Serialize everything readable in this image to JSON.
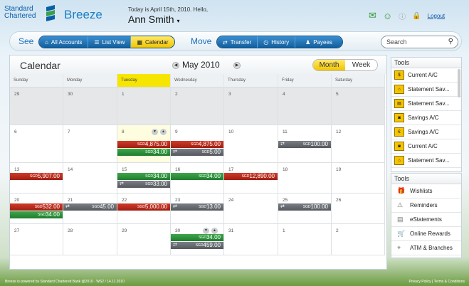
{
  "header": {
    "logo_line1": "Standard",
    "logo_line2": "Chartered",
    "brand": "Breeze",
    "greeting": "Today is April 15th, 2010. Hello,",
    "user": "Ann Smith",
    "logout": "Logout"
  },
  "nav": {
    "see": "See",
    "move": "Move",
    "see_buttons": [
      {
        "label": "All Accounts"
      },
      {
        "label": "List View"
      },
      {
        "label": "Calendar"
      }
    ],
    "move_buttons": [
      {
        "label": "Transfer"
      },
      {
        "label": "History"
      },
      {
        "label": "Payees"
      }
    ],
    "search_placeholder": "Search"
  },
  "calendar": {
    "title": "Calendar",
    "month": "May 2010",
    "view_month": "Month",
    "view_week": "Week",
    "days": [
      "Sunday",
      "Monday",
      "Tuesday",
      "Wednesday",
      "Thursday",
      "Friday",
      "Saturday"
    ],
    "weeks": [
      [
        {
          "d": "29"
        },
        {
          "d": "30"
        },
        {
          "d": "1"
        },
        {
          "d": "2"
        },
        {
          "d": "3"
        },
        {
          "d": "4"
        },
        {
          "d": "5"
        }
      ],
      [
        {
          "d": "6"
        },
        {
          "d": "7"
        },
        {
          "d": "8",
          "ev": [
            {
              "c": "red",
              "t": "4,875.00"
            },
            {
              "c": "green",
              "t": "34.00"
            }
          ]
        },
        {
          "d": "9",
          "ev": [
            {
              "c": "red",
              "t": "4,875.00"
            },
            {
              "c": "grey",
              "t": "5.00",
              "ar": true
            }
          ]
        },
        {
          "d": "10"
        },
        {
          "d": "11",
          "ev": [
            {
              "c": "grey",
              "t": "100.00",
              "ar": true
            }
          ]
        },
        {
          "d": "12"
        }
      ],
      [
        {
          "d": "13",
          "ev": [
            {
              "c": "red",
              "t": "5,907.00"
            }
          ]
        },
        {
          "d": "14"
        },
        {
          "d": "15",
          "ev": [
            {
              "c": "green",
              "t": "34.00"
            },
            {
              "c": "grey",
              "t": "33.00",
              "ar": true
            }
          ]
        },
        {
          "d": "16",
          "ev": [
            {
              "c": "green",
              "t": "34.00"
            }
          ]
        },
        {
          "d": "17",
          "ev": [
            {
              "c": "red",
              "t": "12,890.00"
            }
          ]
        },
        {
          "d": "18"
        },
        {
          "d": "19"
        }
      ],
      [
        {
          "d": "20",
          "ev": [
            {
              "c": "red",
              "t": "532.00"
            },
            {
              "c": "green",
              "t": "34.00"
            }
          ]
        },
        {
          "d": "21",
          "ev": [
            {
              "c": "grey",
              "t": "45.00",
              "ar": true
            }
          ]
        },
        {
          "d": "22",
          "ev": [
            {
              "c": "red",
              "t": "5,000.00"
            }
          ]
        },
        {
          "d": "23",
          "ev": [
            {
              "c": "grey",
              "t": "13.00",
              "ar": true
            }
          ]
        },
        {
          "d": "24"
        },
        {
          "d": "25",
          "ev": [
            {
              "c": "grey",
              "t": "100.00",
              "ar": true
            }
          ]
        },
        {
          "d": "26"
        }
      ],
      [
        {
          "d": "27"
        },
        {
          "d": "28"
        },
        {
          "d": "29"
        },
        {
          "d": "30",
          "ev": [
            {
              "c": "green",
              "t": "34.00"
            },
            {
              "c": "grey",
              "t": "459.00",
              "ar": true
            }
          ]
        },
        {
          "d": "31"
        },
        {
          "d": "1"
        },
        {
          "d": "2"
        }
      ]
    ],
    "currency": "SGD"
  },
  "tools1": {
    "title": "Tools",
    "items": [
      {
        "label": "Current A/C",
        "icon": "$"
      },
      {
        "label": "Statement Sav...",
        "icon": "⌂"
      },
      {
        "label": "Statement Sav...",
        "icon": "▤"
      },
      {
        "label": "Savings A/C",
        "icon": "◙"
      },
      {
        "label": "Savings A/C",
        "icon": "€"
      },
      {
        "label": "Current A/C",
        "icon": "◙"
      },
      {
        "label": "Statement Sav...",
        "icon": "⌂"
      }
    ]
  },
  "tools2": {
    "title": "Tools",
    "items": [
      {
        "label": "Wishlists",
        "icon": "🎁"
      },
      {
        "label": "Reminders",
        "icon": "⚠"
      },
      {
        "label": "eStatements",
        "icon": "▤"
      },
      {
        "label": "Online Rewards",
        "icon": "🛒"
      },
      {
        "label": "ATM & Branches",
        "icon": "⌖"
      }
    ]
  },
  "footer": {
    "left": "Breeze is powered by Standard Chartered Bank @2010 · WS2 / 14.11.2010",
    "right": "Privacy Policy | Terms & Conditions"
  }
}
